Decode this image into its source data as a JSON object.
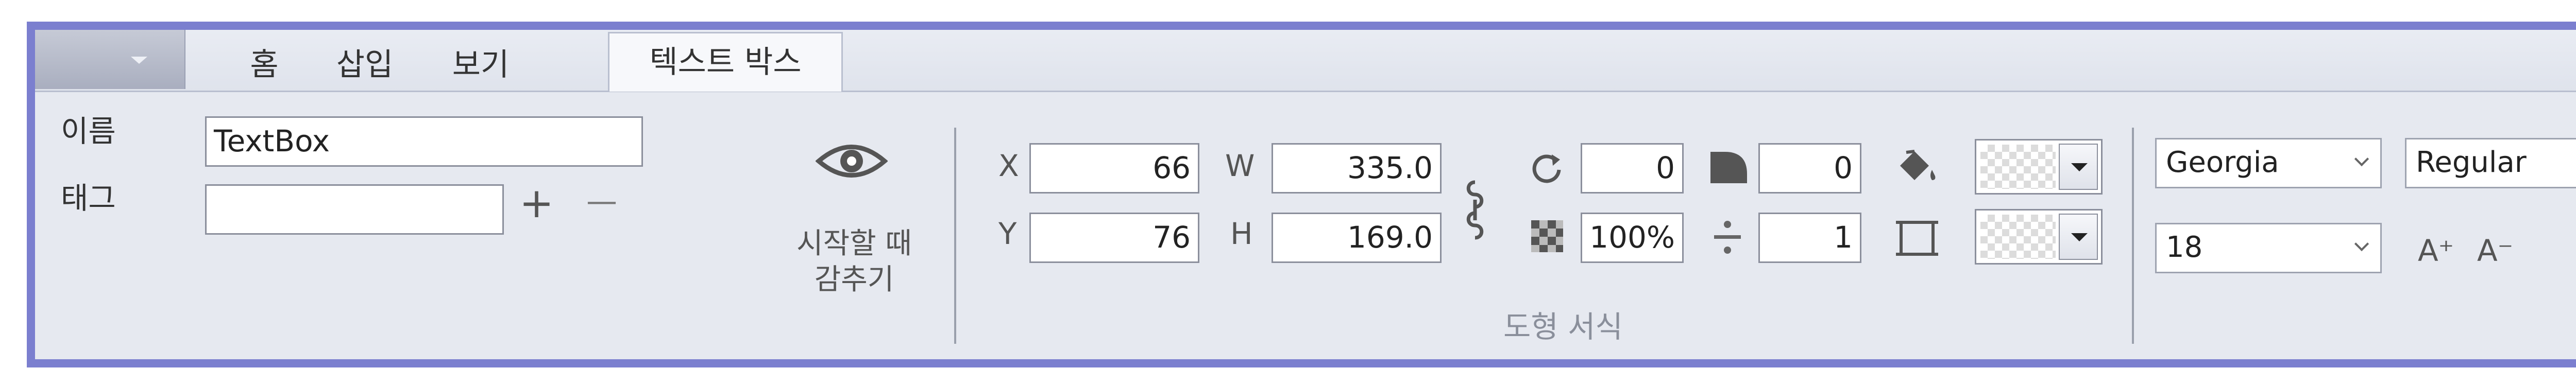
{
  "tabs": [
    "홈",
    "삽입",
    "보기",
    "텍스트 박스"
  ],
  "active_tab": "텍스트 박스",
  "name_tag": {
    "name_label": "이름",
    "name_value": "TextBox",
    "tag_label": "태그",
    "tag_value": "",
    "add_symbol": "+",
    "remove_symbol": "—"
  },
  "visibility": {
    "line1": "시작할 때",
    "line2": "감추기",
    "icon": "eye-icon"
  },
  "geometry": {
    "x_label": "X",
    "x_value": "66",
    "y_label": "Y",
    "y_value": "76",
    "w_label": "W",
    "w_value": "335.0",
    "h_label": "H",
    "h_value": "169.0",
    "link_icon": "link-icon"
  },
  "shape_props": {
    "rotation_value": "0",
    "opacity_value": "100%",
    "corner_value": "0",
    "border_value": "1",
    "icons": [
      "rotate-icon",
      "opacity-icon",
      "corner-radius-icon",
      "border-width-icon",
      "fill-bucket-icon",
      "border-box-icon"
    ]
  },
  "group_label": "도형 서식",
  "font": {
    "family": "Georgia",
    "style": "Regular",
    "size": "18",
    "increase_label": "A⁺",
    "decrease_label": "A⁻"
  },
  "colors": {
    "frame": "#7b7fcf",
    "ribbon_bg": "#e6e9f0"
  }
}
